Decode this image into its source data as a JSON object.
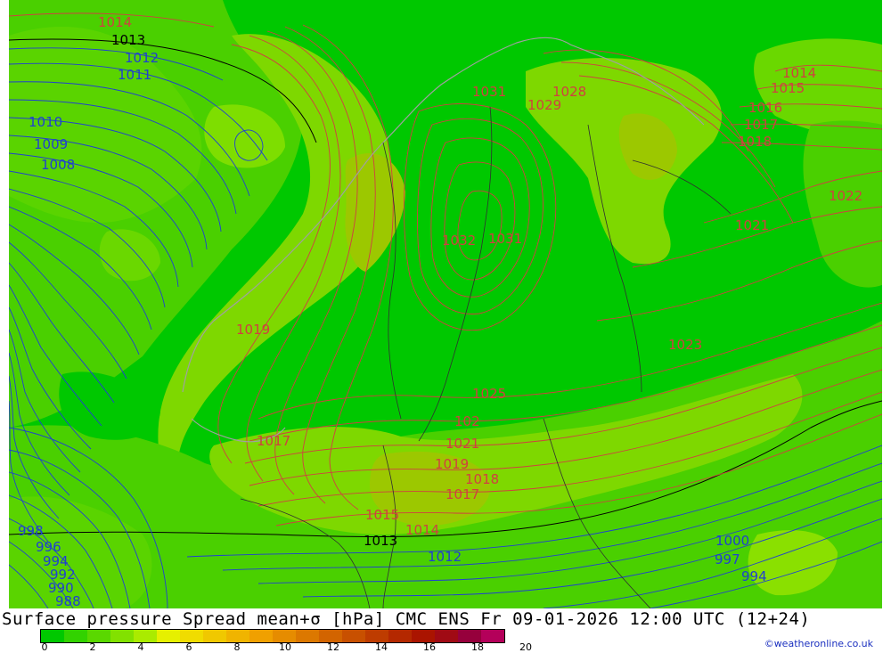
{
  "map": {
    "title": "Surface pressure Spread mean+σ [hPa] CMC ENS Fr 09-01-2026 12:00 UTC (12+24)",
    "credit": "©weatheronline.co.uk",
    "colorbar": {
      "colors": [
        "#00c800",
        "#32d200",
        "#5ad800",
        "#82e100",
        "#aaeb00",
        "#e6f000",
        "#f0dc00",
        "#f0c800",
        "#f0b400",
        "#f0a000",
        "#e68c00",
        "#dc7800",
        "#d26400",
        "#c85000",
        "#be3c00",
        "#b42800",
        "#aa1400",
        "#a00a14",
        "#96003c",
        "#b4005a"
      ],
      "ticks": [
        "0",
        "2",
        "4",
        "6",
        "8",
        "10",
        "12",
        "14",
        "16",
        "18",
        "20"
      ]
    },
    "colors": {
      "base_green": "#00c800",
      "light_green": "#5ad400",
      "pale_green": "#8ae000",
      "olive": "#9cc800",
      "isobar_blue": "#2040d0",
      "isobar_red": "#d04040",
      "isobar_black": "#000000",
      "coast_gray": "#a0a0a0",
      "border_dark": "#303030"
    },
    "isobar_labels": [
      {
        "text": "1014",
        "color": "red"
      },
      {
        "text": "1013",
        "color": "black"
      },
      {
        "text": "1012",
        "color": "blue"
      },
      {
        "text": "1011",
        "color": "blue"
      },
      {
        "text": "1010",
        "color": "blue"
      },
      {
        "text": "1009",
        "color": "blue"
      },
      {
        "text": "1008",
        "color": "blue"
      },
      {
        "text": "1031",
        "color": "red"
      },
      {
        "text": "1028",
        "color": "red"
      },
      {
        "text": "1029",
        "color": "red"
      },
      {
        "text": "1014",
        "color": "red"
      },
      {
        "text": "1015",
        "color": "red"
      },
      {
        "text": "1016",
        "color": "red"
      },
      {
        "text": "1017",
        "color": "red"
      },
      {
        "text": "1018",
        "color": "red"
      },
      {
        "text": "1022",
        "color": "red"
      },
      {
        "text": "1021",
        "color": "red"
      },
      {
        "text": "1032",
        "color": "red"
      },
      {
        "text": "1031",
        "color": "red"
      },
      {
        "text": "1019",
        "color": "red"
      },
      {
        "text": "1023",
        "color": "red"
      },
      {
        "text": "1025",
        "color": "red"
      },
      {
        "text": "102",
        "color": "red"
      },
      {
        "text": "1021",
        "color": "red"
      },
      {
        "text": "1017",
        "color": "red"
      },
      {
        "text": "1019",
        "color": "red"
      },
      {
        "text": "1018",
        "color": "red"
      },
      {
        "text": "1017",
        "color": "red"
      },
      {
        "text": "1015",
        "color": "red"
      },
      {
        "text": "1014",
        "color": "red"
      },
      {
        "text": "1013",
        "color": "black"
      },
      {
        "text": "1012",
        "color": "blue"
      },
      {
        "text": "1000",
        "color": "blue"
      },
      {
        "text": "997",
        "color": "blue"
      },
      {
        "text": "994",
        "color": "blue"
      },
      {
        "text": "998",
        "color": "blue"
      },
      {
        "text": "996",
        "color": "blue"
      },
      {
        "text": "994",
        "color": "blue"
      },
      {
        "text": "992",
        "color": "blue"
      },
      {
        "text": "990",
        "color": "blue"
      },
      {
        "text": "988",
        "color": "blue"
      }
    ]
  }
}
